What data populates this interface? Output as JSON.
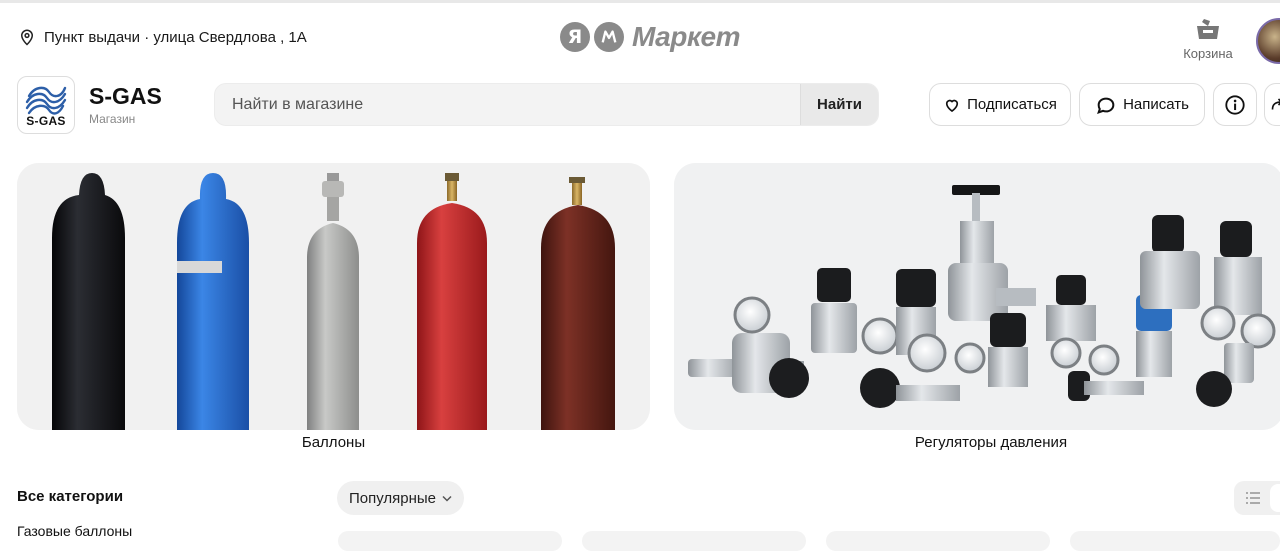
{
  "header": {
    "pickup_label": "Пункт выдачи · улица Свердлова , 1А",
    "logo": {
      "mark": "Я",
      "text": "Маркет"
    },
    "cart_label": "Корзина"
  },
  "shop": {
    "logo_text": "S-GAS",
    "name": "S-GAS",
    "type": "Магазин",
    "search_placeholder": "Найти в магазине",
    "search_button": "Найти",
    "subscribe_label": "Подписаться",
    "write_label": "Написать"
  },
  "banners": [
    {
      "caption": "Баллоны"
    },
    {
      "caption": "Регуляторы давления"
    }
  ],
  "catalog": {
    "all_categories": "Все категории",
    "first_category": "Газовые баллоны",
    "sort_label": "Популярные"
  },
  "colors": {
    "cylinder_black": "#15161a",
    "cylinder_blue": "#2a6fd0",
    "cylinder_gray": "#a9aaa8",
    "cylinder_red": "#c4282b",
    "cylinder_brown": "#6a261f"
  }
}
